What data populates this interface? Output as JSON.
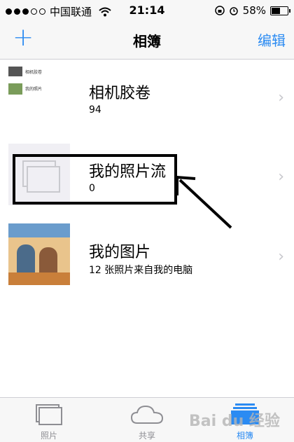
{
  "status_bar": {
    "carrier": "中国联通",
    "time": "21:14",
    "battery": "58%"
  },
  "nav": {
    "add_label": "+",
    "title": "相簿",
    "edit_label": "编辑"
  },
  "albums": [
    {
      "title": "相机胶卷",
      "subtitle": "94",
      "thumb_lines": [
        "相机胶卷",
        "我的照片"
      ]
    },
    {
      "title": "我的照片流",
      "subtitle": "0"
    },
    {
      "title": "我的图片",
      "subtitle": "12 张照片来自我的电脑"
    }
  ],
  "chevron": "›",
  "tabs": [
    {
      "label": "照片"
    },
    {
      "label": "共享"
    },
    {
      "label": "相簿",
      "active": true
    }
  ],
  "watermark": "Bai du 经验",
  "colors": {
    "accent": "#2b8bf2",
    "separator": "#cfcfd4"
  }
}
